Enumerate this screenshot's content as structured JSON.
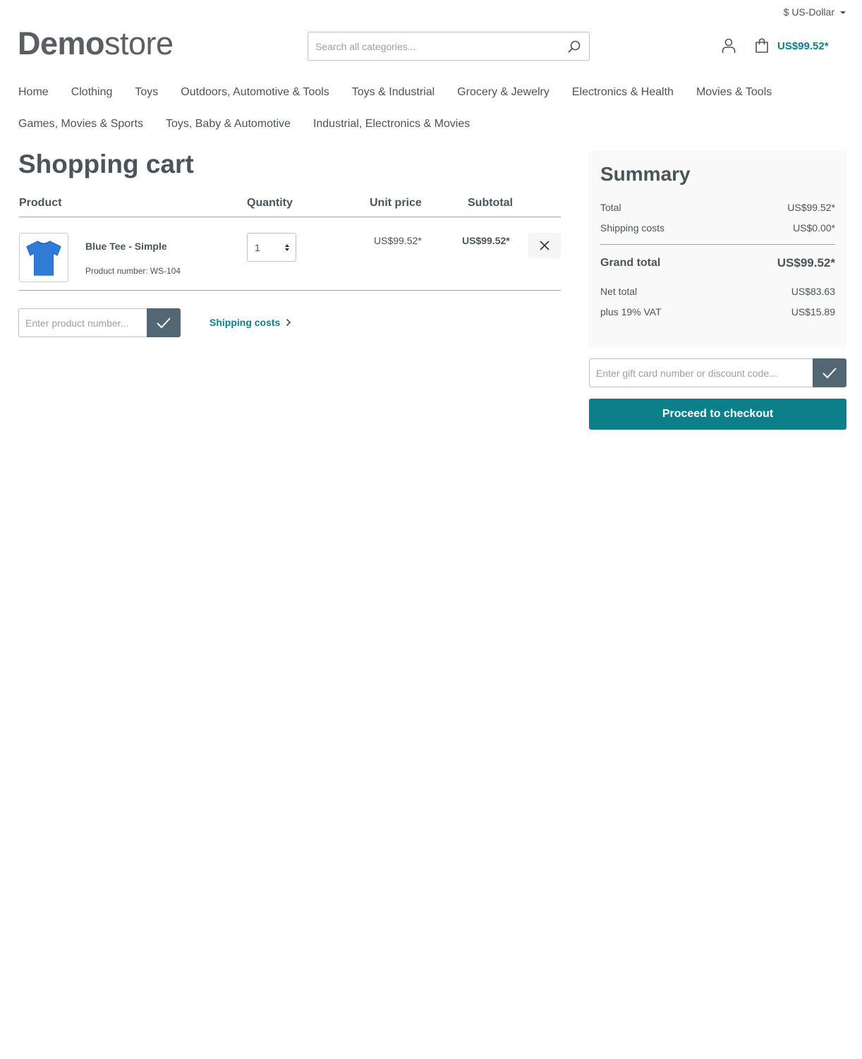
{
  "header": {
    "currency_label": "$ US-Dollar",
    "logo": {
      "bold": "Demo",
      "light": "store"
    },
    "search_placeholder": "Search all categories...",
    "cart_total": "US$99.52*"
  },
  "nav": {
    "row1": [
      "Home",
      "Clothing",
      "Toys",
      "Outdoors, Automotive & Tools",
      "Toys & Industrial",
      "Grocery & Jewelry",
      "Electronics & Health",
      "Movies & Tools"
    ],
    "row2": [
      "Games, Movies & Sports",
      "Toys, Baby & Automotive",
      "Industrial, Electronics & Movies"
    ]
  },
  "cart": {
    "title": "Shopping cart",
    "columns": {
      "product": "Product",
      "quantity": "Quantity",
      "unit_price": "Unit price",
      "subtotal": "Subtotal"
    },
    "items": [
      {
        "name": "Blue Tee - Simple",
        "number_label": "Product number:",
        "number": "WS-104",
        "quantity": "1",
        "unit_price": "US$99.52*",
        "subtotal": "US$99.52*",
        "image_color": "#2f7bd6"
      }
    ],
    "add_product_placeholder": "Enter product number...",
    "shipping_link": "Shipping costs"
  },
  "summary": {
    "title": "Summary",
    "total_label": "Total",
    "total_value": "US$99.52*",
    "shipping_label": "Shipping costs",
    "shipping_value": "US$0.00*",
    "grand_total_label": "Grand total",
    "grand_total_value": "US$99.52*",
    "net_label": "Net total",
    "net_value": "US$83.63",
    "vat_label": "plus 19% VAT",
    "vat_value": "US$15.89",
    "discount_placeholder": "Enter gift card number or discount code...",
    "checkout_label": "Proceed to checkout"
  },
  "colors": {
    "accent": "#0b7f8a",
    "button_dark": "#526773",
    "text": "#4a545b"
  }
}
